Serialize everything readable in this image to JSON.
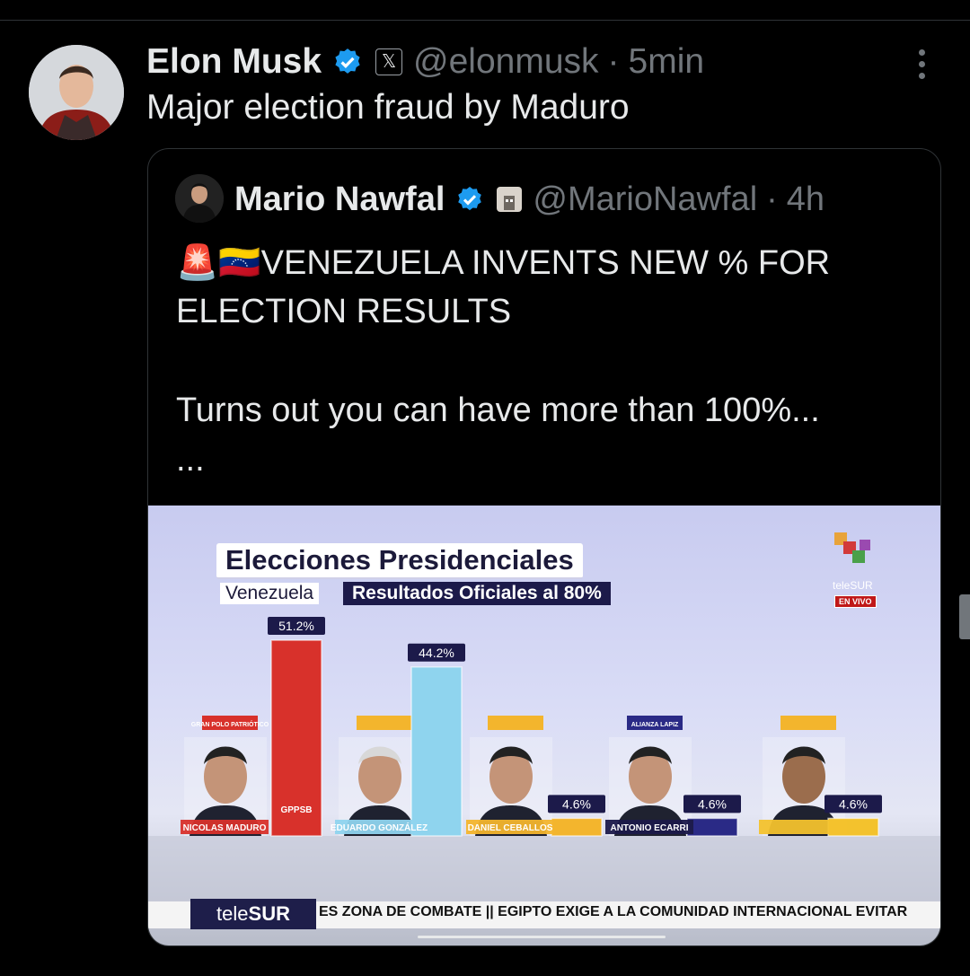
{
  "post": {
    "author_name": "Elon Musk",
    "handle": "@elonmusk",
    "separator": "·",
    "time": "5min",
    "text": "Major election fraud by Maduro",
    "icons": [
      "verified-badge-icon",
      "x-affiliate-icon",
      "more-icon"
    ]
  },
  "quoted": {
    "author_name": "Mario Nawfal",
    "handle": "@MarioNawfal",
    "separator": "·",
    "time": "4h",
    "line1": "🚨🇻🇪VENEZUELA INVENTS NEW % FOR",
    "line2": "ELECTION RESULTS",
    "line3": "Turns out you can have more than 100%...",
    "line4": "...",
    "icons": [
      "verified-badge-icon",
      "affiliate-badge-icon"
    ]
  },
  "media": {
    "title": "Elecciones Presidenciales",
    "country": "Venezuela",
    "subtitle": "Resultados Oficiales al 80%",
    "channel": "teleSUR",
    "live": "EN VIVO",
    "ticker_logo_a": "tele",
    "ticker_logo_b": "SUR",
    "ticker": "ES ZONA DE COMBATE  ||  EGIPTO EXIGE A LA COMUNIDAD INTERNACIONAL EVITAR"
  },
  "chart_data": {
    "type": "bar",
    "title": "Elecciones Presidenciales",
    "subtitle": "Resultados Oficiales al 80%",
    "categories": [
      "NICOLAS MADURO",
      "EDUARDO GONZÁLEZ",
      "DANIEL CEBALLOS",
      "ANTONIO ECARRI",
      ""
    ],
    "values": [
      51.2,
      44.2,
      4.6,
      4.6,
      4.6
    ],
    "value_labels": [
      "51.2%",
      "44.2%",
      "4.6%",
      "4.6%",
      "4.6%"
    ],
    "party_tags": [
      "GRAN POLO PATRIÓTICO",
      "",
      "",
      "ALIANZA LAPIZ",
      ""
    ],
    "party_logos": [
      "GPPSB",
      "",
      "",
      "LAPIZ",
      ""
    ],
    "colors": [
      "#d8312b",
      "#8fd4ee",
      "#f3b52d",
      "#2a2a86",
      "#f3c22d"
    ]
  }
}
